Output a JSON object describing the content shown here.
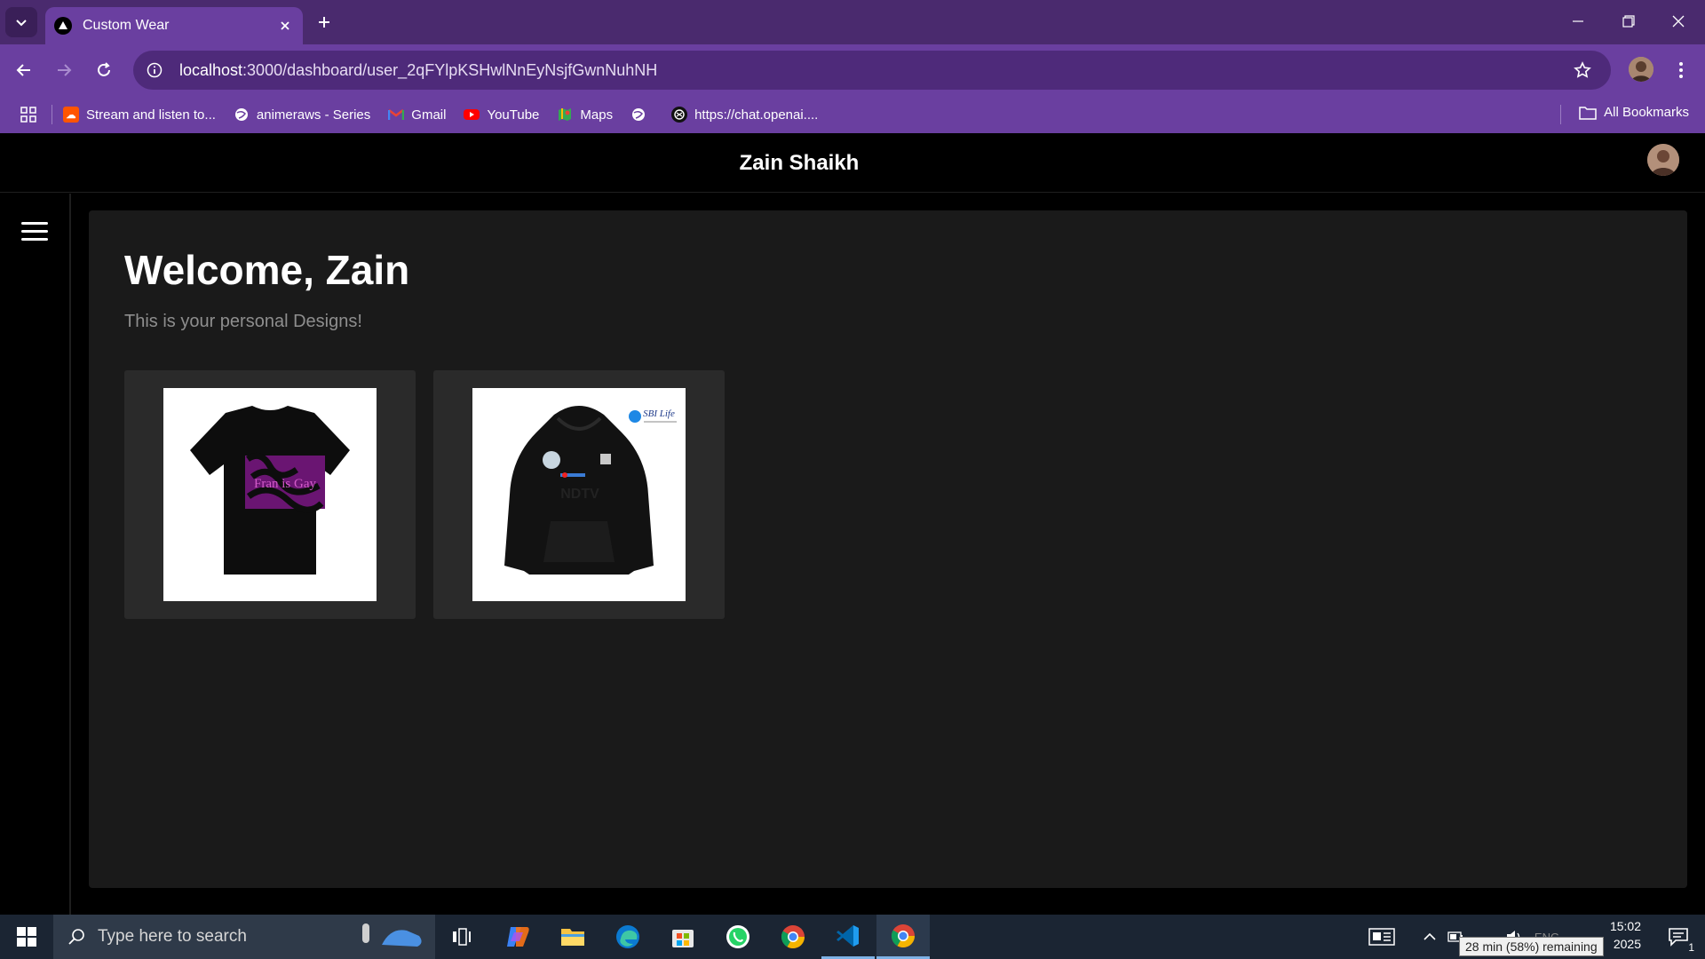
{
  "browser": {
    "tab_title": "Custom Wear",
    "url_host": "localhost",
    "url_rest": ":3000/dashboard/user_2qFYlpKSHwlNnEyNsjfGwnNuhNH",
    "bookmarks": [
      {
        "label": "Stream and listen to...",
        "icon": "soundcloud-icon",
        "color": "#ff5500"
      },
      {
        "label": "animeraws - Series",
        "icon": "globe-icon",
        "color": "#ffffff"
      },
      {
        "label": "Gmail",
        "icon": "gmail-icon",
        "color": "#ea4335"
      },
      {
        "label": "YouTube",
        "icon": "youtube-icon",
        "color": "#ff0000"
      },
      {
        "label": "Maps",
        "icon": "maps-icon",
        "color": "#34a853"
      },
      {
        "label": "",
        "icon": "globe-icon",
        "color": "#ffffff"
      },
      {
        "label": "https://chat.openai....",
        "icon": "chatgpt-icon",
        "color": "#ffffff"
      }
    ],
    "all_bookmarks_label": "All Bookmarks"
  },
  "app": {
    "title": "Zain Shaikh",
    "welcome": "Welcome, Zain",
    "subtitle": "This is your personal Designs!",
    "designs": [
      {
        "type": "tshirt",
        "print_text": "Fran is Gay"
      },
      {
        "type": "hoodie",
        "print_text": "NDTV",
        "logo_text": "SBI Life"
      }
    ]
  },
  "taskbar": {
    "search_placeholder": "Type here to search",
    "time": "15:02",
    "date_fragment": "2025",
    "battery_tooltip": "28 min (58%) remaining",
    "lang": "ENG",
    "notification_count": "1"
  },
  "colors": {
    "chrome_dark": "#4a2a6e",
    "chrome": "#6a3fa0",
    "panel": "#1a1a1a",
    "card": "#2a2a2a"
  }
}
